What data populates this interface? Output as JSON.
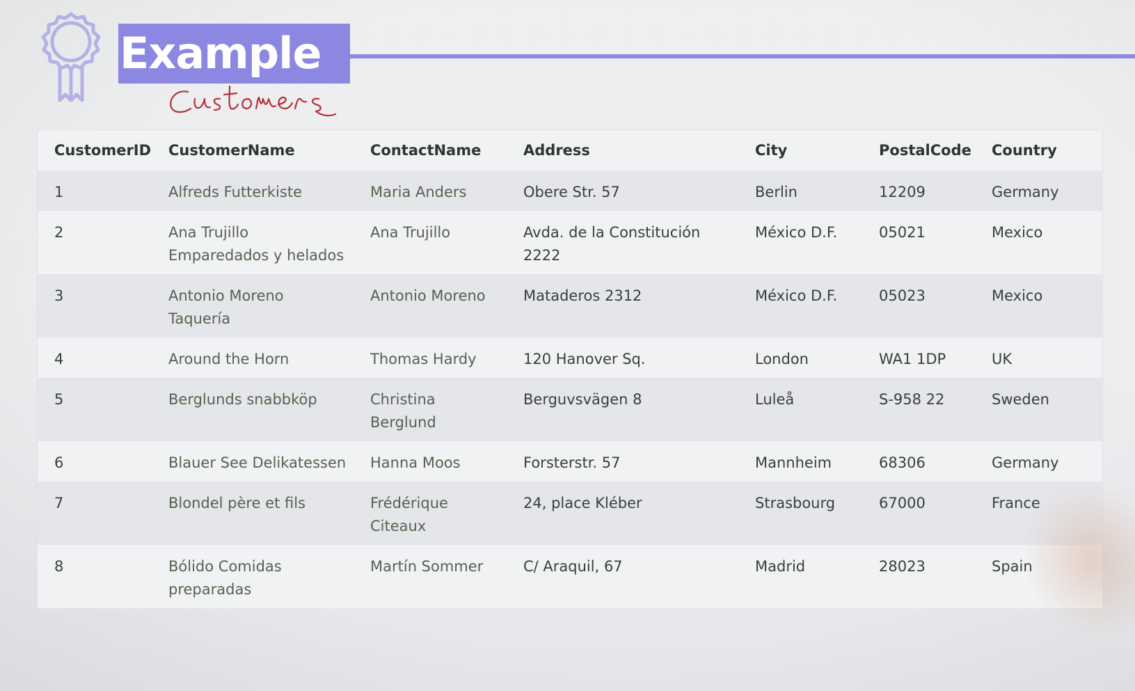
{
  "header": {
    "title": "Example",
    "subtitle_handwritten": "Customers",
    "accent_color": "#8c87e0",
    "badge_icon": "award-ribbon-icon"
  },
  "table": {
    "columns": [
      "CustomerID",
      "CustomerName",
      "ContactName",
      "Address",
      "City",
      "PostalCode",
      "Country"
    ],
    "rows": [
      [
        "1",
        "Alfreds Futterkiste",
        "Maria Anders",
        "Obere Str. 57",
        "Berlin",
        "12209",
        "Germany"
      ],
      [
        "2",
        "Ana Trujillo Emparedados y helados",
        "Ana Trujillo",
        "Avda. de la Constitución 2222",
        "México D.F.",
        "05021",
        "Mexico"
      ],
      [
        "3",
        "Antonio Moreno Taquería",
        "Antonio Moreno",
        "Mataderos 2312",
        "México D.F.",
        "05023",
        "Mexico"
      ],
      [
        "4",
        "Around the Horn",
        "Thomas Hardy",
        "120 Hanover Sq.",
        "London",
        "WA1 1DP",
        "UK"
      ],
      [
        "5",
        "Berglunds snabbköp",
        "Christina Berglund",
        "Berguvsvägen 8",
        "Luleå",
        "S-958 22",
        "Sweden"
      ],
      [
        "6",
        "Blauer See Delikatessen",
        "Hanna Moos",
        "Forsterstr. 57",
        "Mannheim",
        "68306",
        "Germany"
      ],
      [
        "7",
        "Blondel père et fils",
        "Frédérique Citeaux",
        "24, place Kléber",
        "Strasbourg",
        "67000",
        "France"
      ],
      [
        "8",
        "Bólido Comidas preparadas",
        "Martín Sommer",
        "C/ Araquil, 67",
        "Madrid",
        "28023",
        "Spain"
      ]
    ]
  }
}
